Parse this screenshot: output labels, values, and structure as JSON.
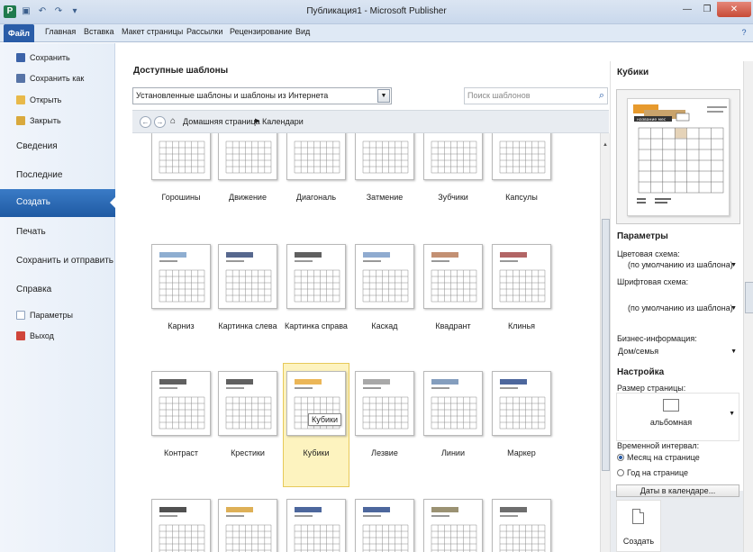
{
  "window": {
    "title": "Публикация1 - Microsoft Publisher",
    "app_icon": "P",
    "qat_icons": [
      "save-icon",
      "undo-icon",
      "redo-icon",
      "customize-icon"
    ]
  },
  "ribbon": {
    "file_tab": "Файл",
    "tabs": [
      "Главная",
      "Вставка",
      "Макет страницы",
      "Рассылки",
      "Рецензирование",
      "Вид"
    ]
  },
  "nav": {
    "save": "Сохранить",
    "save_as": "Сохранить как",
    "open": "Открыть",
    "close": "Закрыть",
    "info": "Сведения",
    "recent": "Последние",
    "create": "Создать",
    "print": "Печать",
    "save_send": "Сохранить и отправить",
    "help": "Справка",
    "options": "Параметры",
    "exit": "Выход"
  },
  "main": {
    "title": "Доступные шаблоны",
    "source_combo": "Установленные шаблоны и шаблоны из Интернета",
    "search_placeholder": "Поиск шаблонов",
    "breadcrumb_home": "Домашняя страница",
    "breadcrumb_current": "Календари",
    "tooltip": "Кубики",
    "rows": [
      [
        "Горошины",
        "Движение",
        "Диагональ",
        "Затмение",
        "Зубчики",
        "Капсулы"
      ],
      [
        "Карниз",
        "Картинка слева",
        "Картинка справа",
        "Каскад",
        "Квадрант",
        "Клинья"
      ],
      [
        "Контраст",
        "Крестики",
        "Кубики",
        "Лезвие",
        "Линии",
        "Маркер"
      ],
      [
        "",
        "",
        "",
        "",
        "",
        ""
      ]
    ],
    "selected": "Кубики"
  },
  "panel": {
    "title": "Кубики",
    "params_heading": "Параметры",
    "color_scheme_label": "Цветовая схема:",
    "color_scheme_value": "(по умолчанию из шаблона)",
    "font_scheme_label": "Шрифтовая схема:",
    "font_scheme_value": "(по умолчанию из шаблона)",
    "biz_label": "Бизнес-информация:",
    "biz_value": "Дом/семья",
    "setup_heading": "Настройка",
    "page_size_label": "Размер страницы:",
    "page_size_value": "альбомная",
    "interval_label": "Временной интервал:",
    "month_option": "Месяц на странице",
    "year_option": "Год на странице",
    "dates_button": "Даты в календаре...",
    "create_button": "Создать",
    "preview_heading": "название мес"
  }
}
